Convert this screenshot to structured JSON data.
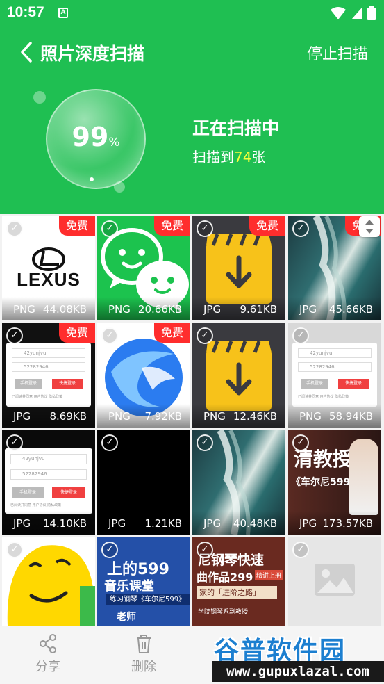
{
  "status_bar": {
    "time": "10:57",
    "sim_label": "A"
  },
  "header": {
    "title": "照片深度扫描",
    "stop_label": "停止扫描",
    "progress_value": "99",
    "progress_unit": "%",
    "status_title": "正在扫描中",
    "scanned_prefix": "扫描到",
    "scanned_count": "74",
    "scanned_suffix": "张",
    "colors": {
      "header_bg": "#1fbf52",
      "count_highlight": "#f4ff3a",
      "badge_bg": "#ff2d2d"
    }
  },
  "photos": [
    {
      "type": "PNG",
      "size": "44.08KB",
      "badge": "免费",
      "thumb": "lexus-logo"
    },
    {
      "type": "PNG",
      "size": "20.66KB",
      "badge": "免费",
      "thumb": "wechat-logo"
    },
    {
      "type": "JPG",
      "size": "9.61KB",
      "badge": "免费",
      "thumb": "download-clapper"
    },
    {
      "type": "JPG",
      "size": "45.66KB",
      "badge": "免费",
      "thumb": "ocean-shore"
    },
    {
      "type": "JPG",
      "size": "8.69KB",
      "badge": "免费",
      "thumb": "login-form"
    },
    {
      "type": "PNG",
      "size": "7.92KB",
      "badge": "免费",
      "thumb": "blue-swirl-logo"
    },
    {
      "type": "PNG",
      "size": "12.46KB",
      "badge": "",
      "thumb": "download-clapper"
    },
    {
      "type": "PNG",
      "size": "58.94KB",
      "badge": "",
      "thumb": "login-form"
    },
    {
      "type": "JPG",
      "size": "14.10KB",
      "badge": "",
      "thumb": "login-form-dark"
    },
    {
      "type": "JPG",
      "size": "1.21KB",
      "badge": "",
      "thumb": "black"
    },
    {
      "type": "JPG",
      "size": "40.48KB",
      "badge": "",
      "thumb": "ocean-shore"
    },
    {
      "type": "JPG",
      "size": "173.57KB",
      "badge": "",
      "thumb": "piano-teacher"
    },
    {
      "type": "",
      "size": "",
      "badge": "",
      "thumb": "yellow-face"
    },
    {
      "type": "",
      "size": "",
      "badge": "",
      "thumb": "music-class"
    },
    {
      "type": "",
      "size": "",
      "badge": "",
      "thumb": "piano-fast"
    },
    {
      "type": "",
      "size": "",
      "badge": "",
      "thumb": "image-placeholder"
    }
  ],
  "thumb_text": {
    "lexus": "LEXUS",
    "login_user": "42yunjvu",
    "login_pass": "52282946",
    "login_btn_left": "手机登录",
    "login_btn_right": "快捷登录",
    "login_agree": "已阅读并同意 用户协议 隐私政策",
    "piano_title": "清教授",
    "piano_book": "《车尔尼599》",
    "music_title": "上的599",
    "music_sub": "音乐课堂",
    "music_note": "练习钢琴《车尔尼599》",
    "music_teacher": "老师",
    "fast_title": "尼钢琴快速",
    "fast_sub": "曲作品299",
    "fast_tag": "精讲上册",
    "fast_path": "家的「进阶之路」",
    "fast_note": "学院钢琴系副教授"
  },
  "bottom_bar": {
    "share_label": "分享",
    "delete_label": "删除"
  },
  "watermark": {
    "title": "谷普软件园",
    "url": "www.gupuxlazal.com"
  }
}
